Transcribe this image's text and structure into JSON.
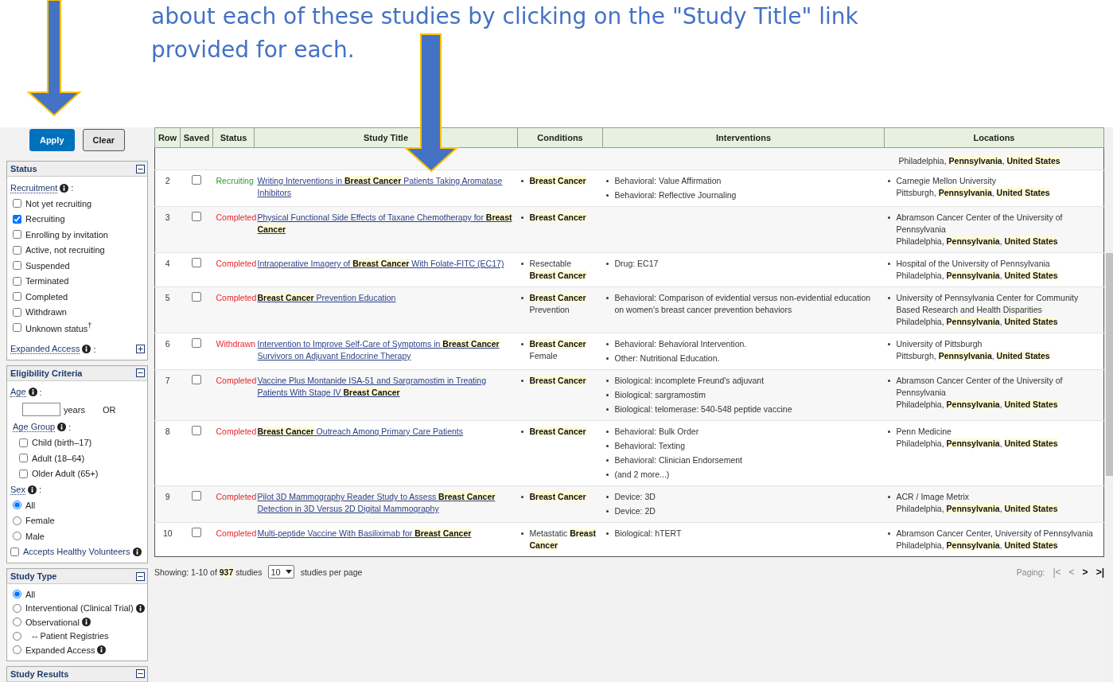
{
  "intro": {
    "lines": [
      "about each of these studies by clicking on the \"Study Title\" link",
      "provided for each."
    ]
  },
  "sidebar": {
    "buttons": [
      {
        "label": "Apply",
        "kind": "primary"
      },
      {
        "label": "Clear",
        "kind": "secondary"
      }
    ],
    "panels": [
      {
        "title": "Status",
        "expanded": true,
        "items": [
          {
            "kind": "heading",
            "label": "Recruitment",
            "info": true,
            "colon": ":",
            "children": [
              {
                "kind": "checkbox",
                "label": "Not yet recruiting",
                "checked": false
              },
              {
                "kind": "checkbox",
                "label": "Recruiting",
                "checked": true
              },
              {
                "kind": "checkbox",
                "label": "Enrolling by invitation",
                "checked": false
              },
              {
                "kind": "checkbox",
                "label": "Active, not recruiting",
                "checked": false
              },
              {
                "kind": "checkbox",
                "label": "Suspended",
                "checked": false
              },
              {
                "kind": "checkbox",
                "label": "Terminated",
                "checked": false
              },
              {
                "kind": "checkbox",
                "label": "Completed",
                "checked": false
              },
              {
                "kind": "checkbox",
                "label": "Withdrawn",
                "checked": false
              },
              {
                "kind": "checkbox",
                "label": "Unknown status$^{†}$",
                "checked": false
              }
            ]
          },
          {
            "kind": "toggle",
            "label": "Expanded Access",
            "info": true,
            "colon": ":",
            "expanded": false
          }
        ]
      },
      {
        "title": "Eligibility Criteria",
        "expanded": true,
        "items": [
          {
            "kind": "heading",
            "label": "Age",
            "info": true,
            "colon": ":",
            "children": [
              {
                "kind": "age",
                "unit": "years",
                "alt": "OR"
              },
              {
                "kind": "heading",
                "label": "Age Group",
                "info": true,
                "colon": ":",
                "children": [
                  {
                    "kind": "checkbox",
                    "label": "Child (birth–17)",
                    "checked": false
                  },
                  {
                    "kind": "checkbox",
                    "label": "Adult (18–64)",
                    "checked": false
                  },
                  {
                    "kind": "checkbox",
                    "label": "Older Adult (65+)",
                    "checked": false
                  }
                ]
              }
            ]
          },
          {
            "kind": "heading",
            "label": "Sex",
            "info": true,
            "colon": ":",
            "children": [
              {
                "kind": "radio",
                "label": "All",
                "selected": true
              },
              {
                "kind": "radio",
                "label": "Female",
                "selected": false
              },
              {
                "kind": "radio",
                "label": "Male",
                "selected": false
              }
            ]
          },
          {
            "kind": "link-checkbox",
            "label": "Accepts Healthy Volunteers",
            "info": true,
            "checked": false
          }
        ]
      },
      {
        "title": "Study Type",
        "expanded": true,
        "items": [
          {
            "kind": "group",
            "dense": true,
            "children": [
              {
                "kind": "radio",
                "label": "All",
                "selected": true
              },
              {
                "kind": "radio",
                "label": "Interventional (Clinical Trial)",
                "info": true,
                "selected": false
              },
              {
                "kind": "radio",
                "label": "Observational",
                "info": true,
                "selected": false
              },
              {
                "kind": "radio",
                "label": "-- Patient Registries",
                "sub": true,
                "selected": false
              },
              {
                "kind": "radio",
                "label": "Expanded Access",
                "info": true,
                "selected": false
              }
            ]
          }
        ]
      },
      {
        "title": "Study Results",
        "expanded": true
      }
    ]
  },
  "table": {
    "columns": [
      "Row",
      "Saved",
      "Status",
      "Study Title",
      "Conditions",
      "Interventions",
      "Locations"
    ],
    "rows": [
      {
        "kind": "partial",
        "locations": [
          {
            "place": "Philadelphia, **Pennsylvania**, **United States**"
          }
        ]
      },
      {
        "kind": "full",
        "row": "2",
        "saved": false,
        "status": "Recruiting",
        "color": "#339933",
        "title": "Writing Interventions in **Breast Cancer** Patients Taking Aromatase Inhibitors",
        "conditions": [
          "**Breast Cancer**"
        ],
        "interventions": [
          "Behavioral: Value Affirmation",
          "Behavioral: Reflective Journaling"
        ],
        "locations": [
          {
            "name": "Carnegie Mellon University",
            "place": "Pittsburgh, **Pennsylvania**, **United States**"
          }
        ]
      },
      {
        "kind": "full",
        "row": "3",
        "saved": false,
        "status": "Completed",
        "color": "#e8262b",
        "title": "Physical Functional Side Effects of Taxane Chemotherapy for **Breast Cancer**",
        "conditions": [
          "**Breast Cancer**"
        ],
        "locations": [
          {
            "name": "Abramson Cancer Center of the University of Pennsylvania",
            "place": "Philadelphia, **Pennsylvania**, **United States**"
          }
        ]
      },
      {
        "kind": "full",
        "row": "4",
        "saved": false,
        "status": "Completed",
        "color": "#e8262b",
        "title": "Intraoperative Imagery of **Breast Cancer** With Folate-FITC (EC17)",
        "conditions": [
          "Resectable **Breast Cancer**"
        ],
        "interventions": [
          "Drug: EC17"
        ],
        "locations": [
          {
            "name": "Hospital of the University of Pennsylvania",
            "place": "Philadelphia, **Pennsylvania**, **United States**"
          }
        ]
      },
      {
        "kind": "full",
        "row": "5",
        "saved": false,
        "status": "Completed",
        "color": "#e8262b",
        "title": "**Breast Cancer** Prevention Education",
        "conditions": [
          "**Breast Cancer** Prevention"
        ],
        "interventions": [
          "Behavioral: Comparison of evidential versus non-evidential education on women's breast cancer prevention behaviors"
        ],
        "locations": [
          {
            "name": "University of Pennsylvania Center for Community Based Research and Health Disparities",
            "place": "Philadelphia, **Pennsylvania**, **United States**"
          }
        ]
      },
      {
        "kind": "full",
        "row": "6",
        "saved": false,
        "status": "Withdrawn",
        "color": "#e8262b",
        "title": "Intervention to Improve Self-Care of Symptoms in **Breast Cancer** Survivors on Adjuvant Endocrine Therapy",
        "conditions": [
          "**Breast Cancer** Female"
        ],
        "interventions": [
          "Behavioral: Behavioral Intervention.",
          "Other: Nutritional Education."
        ],
        "locations": [
          {
            "name": "University of Pittsburgh",
            "place": "Pittsburgh, **Pennsylvania**, **United States**"
          }
        ]
      },
      {
        "kind": "full",
        "row": "7",
        "saved": false,
        "status": "Completed",
        "color": "#e8262b",
        "title": "Vaccine Plus Montanide ISA-51 and Sargramostim in Treating Patients With Stage IV **Breast Cancer**",
        "conditions": [
          "**Breast Cancer**"
        ],
        "interventions": [
          "Biological: incomplete Freund's adjuvant",
          "Biological: sargramostim",
          "Biological: telomerase: 540-548 peptide vaccine"
        ],
        "locations": [
          {
            "name": "Abramson Cancer Center of the University of Pennsylvania",
            "place": "Philadelphia, **Pennsylvania**, **United States**"
          }
        ]
      },
      {
        "kind": "full",
        "row": "8",
        "saved": false,
        "status": "Completed",
        "color": "#e8262b",
        "title": "**Breast Cancer** Outreach Among Primary Care Patients",
        "conditions": [
          "**Breast Cancer**"
        ],
        "interventions": [
          "Behavioral: Bulk Order",
          "Behavioral: Texting",
          "Behavioral: Clinician Endorsement",
          "(and 2 more...)"
        ],
        "locations": [
          {
            "name": "Penn Medicine",
            "place": "Philadelphia, **Pennsylvania**, **United States**"
          }
        ]
      },
      {
        "kind": "full",
        "row": "9",
        "saved": false,
        "status": "Completed",
        "color": "#e8262b",
        "title": "Pilot 3D Mammography Reader Study to Assess **Breast Cancer** Detection in 3D Versus 2D Digital Mammography",
        "conditions": [
          "**Breast Cancer**"
        ],
        "interventions": [
          "Device: 3D",
          "Device: 2D"
        ],
        "locations": [
          {
            "name": "ACR / Image Metrix",
            "place": "Philadelphia, **Pennsylvania**, **United States**"
          }
        ]
      },
      {
        "kind": "full",
        "row": "10",
        "saved": false,
        "status": "Completed",
        "color": "#e8262b",
        "title": "Multi-peptide Vaccine With Basiliximab for **Breast Cancer**",
        "conditions": [
          "Metastatic **Breast Cancer**"
        ],
        "interventions": [
          "Biological: hTERT"
        ],
        "locations": [
          {
            "name": "Abramson Cancer Center, University of Pennsylvania",
            "place": "Philadelphia, **Pennsylvania**, **United States**"
          }
        ]
      }
    ]
  },
  "footer": {
    "showing": "Showing: 1-10 of **937** studies",
    "per_page": "10",
    "per_page_label": "studies per page",
    "paging_label": "Paging:",
    "pager": [
      {
        "label": "|<",
        "disabled": true
      },
      {
        "label": "<",
        "disabled": true
      },
      {
        "label": ">",
        "disabled": false
      },
      {
        "label": ">|",
        "disabled": false
      }
    ]
  }
}
